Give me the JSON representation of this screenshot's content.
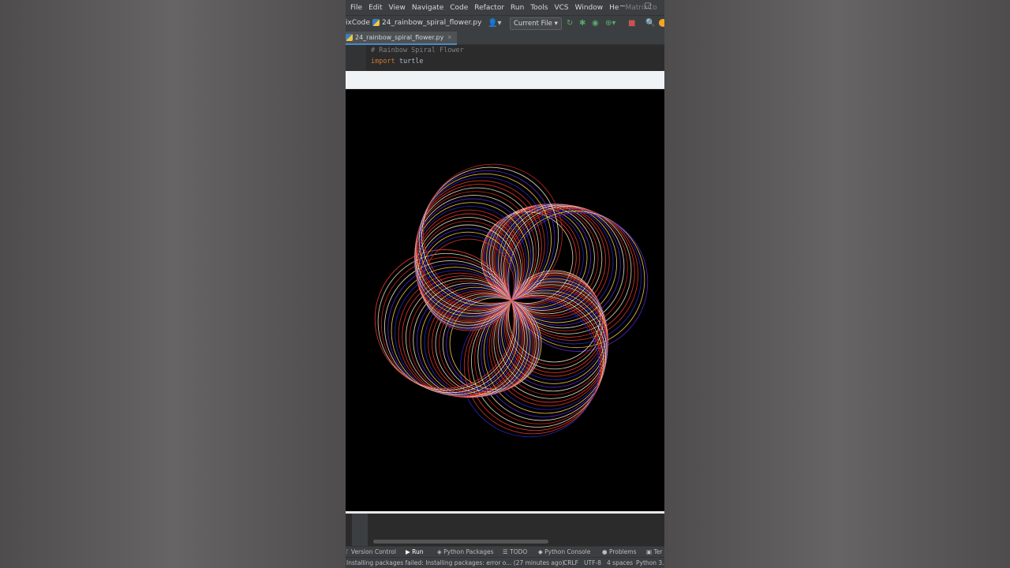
{
  "menu": [
    "File",
    "Edit",
    "View",
    "Navigate",
    "Code",
    "Refactor",
    "Run",
    "Tools",
    "VCS",
    "Window",
    "He"
  ],
  "menu_title": "MatrixCo",
  "toolbar": {
    "project": "ixCode",
    "file": "24_rainbow_spiral_flower.py",
    "run_config": "Current File"
  },
  "tab": {
    "file": "24_rainbow_spiral_flower.py"
  },
  "code": {
    "comment": "# Rainbow Spiral Flower",
    "keyword": "import",
    "module": " turtle"
  },
  "tool_windows": [
    "Version Control",
    "Run",
    "Python Packages",
    "TODO",
    "Python Console",
    "Problems",
    "Ter"
  ],
  "status": {
    "message": "Installing packages failed: Installing packages: error o... (27 minutes ago)",
    "line_sep": "CRLF",
    "encoding": "UTF-8",
    "indent": "4 spaces",
    "interpreter": "Python 3."
  },
  "colors": {
    "spiral": [
      "#e8e8c0",
      "#ff3b2f",
      "#e03a28",
      "#2a2acc",
      "#ffd24a",
      "#5a2ad8",
      "#f5f0d0",
      "#d42a1e"
    ],
    "accent": "#4a88c7"
  }
}
